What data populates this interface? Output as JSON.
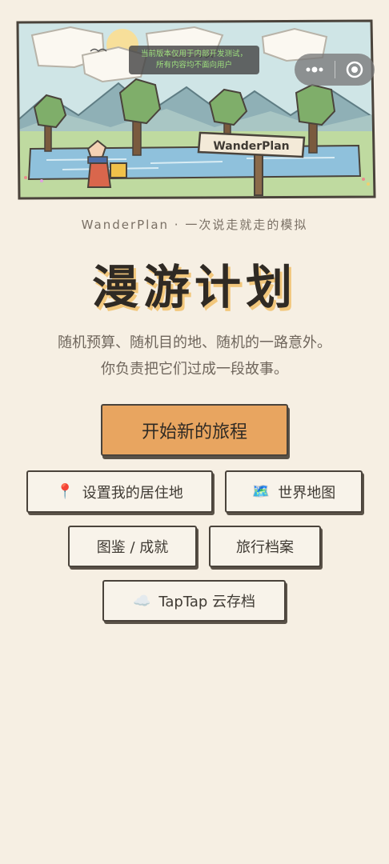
{
  "hero": {
    "sign_text": "WanderPlan"
  },
  "dev_banner": {
    "line1": "当前版本仅用于内部开发测试，",
    "line2": "所有内容均不面向用户"
  },
  "capsule": {
    "more_icon": "more-dots-icon",
    "close_icon": "target-circle-icon"
  },
  "subtitle": "WanderPlan · 一次说走就走的模拟",
  "title": "漫游计划",
  "description": {
    "line1": "随机预算、随机目的地、随机的一路意外。",
    "line2": "你负责把它们过成一段故事。"
  },
  "buttons": {
    "start": "开始新的旅程",
    "home": {
      "icon": "📍",
      "label": "设置我的居住地"
    },
    "world_map": {
      "icon": "🗺️",
      "label": "世界地图"
    },
    "collection": "图鉴 / 成就",
    "archive": "旅行档案",
    "cloud": {
      "icon": "☁️",
      "label": "TapTap 云存档"
    }
  },
  "colors": {
    "background": "#f6efe3",
    "primary_button": "#e8a560",
    "title_shadow": "#f2c77c",
    "banner_text": "#9ee07e"
  }
}
